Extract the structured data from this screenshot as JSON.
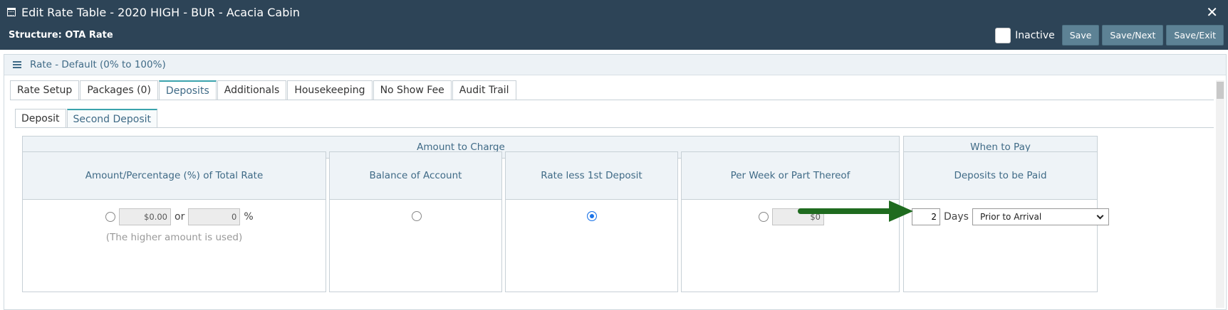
{
  "window": {
    "title": "Edit Rate Table - 2020 HIGH - BUR - Acacia Cabin",
    "close_glyph": "✕",
    "structure_label": "Structure: OTA Rate",
    "inactive_label": "Inactive",
    "buttons": {
      "save": "Save",
      "save_next": "Save/Next",
      "save_exit": "Save/Exit"
    }
  },
  "panel": {
    "title": "Rate - Default (0% to 100%)"
  },
  "tabs": [
    {
      "label": "Rate Setup",
      "active": false
    },
    {
      "label": "Packages (0)",
      "active": false
    },
    {
      "label": "Deposits",
      "active": true
    },
    {
      "label": "Additionals",
      "active": false
    },
    {
      "label": "Housekeeping",
      "active": false
    },
    {
      "label": "No Show Fee",
      "active": false
    },
    {
      "label": "Audit Trail",
      "active": false
    }
  ],
  "subtabs": [
    {
      "label": "Deposit",
      "active": false
    },
    {
      "label": "Second Deposit",
      "active": true
    }
  ],
  "sections": {
    "amount_to_charge": "Amount to Charge",
    "when_to_pay": "When to Pay"
  },
  "columns": {
    "amount_pct": "Amount/Percentage (%) of Total Rate",
    "balance": "Balance of Account",
    "rate_less": "Rate less 1st Deposit",
    "per_week": "Per Week or Part Thereof",
    "deposits_paid": "Deposits to be Paid"
  },
  "form": {
    "amount_value": "$0.00",
    "or_label": "or",
    "percent_value": "0",
    "percent_symbol": "%",
    "higher_note": "(The higher amount is used)",
    "per_week_value": "$0",
    "days_value": "2",
    "days_label": "Days",
    "timing_selected": "Prior to Arrival",
    "selected_option": "rate_less"
  },
  "colors": {
    "header_bg": "#2d4457",
    "button_bg": "#5d8295",
    "accent": "#3aa3ad",
    "arrow": "#1f6b1f"
  }
}
